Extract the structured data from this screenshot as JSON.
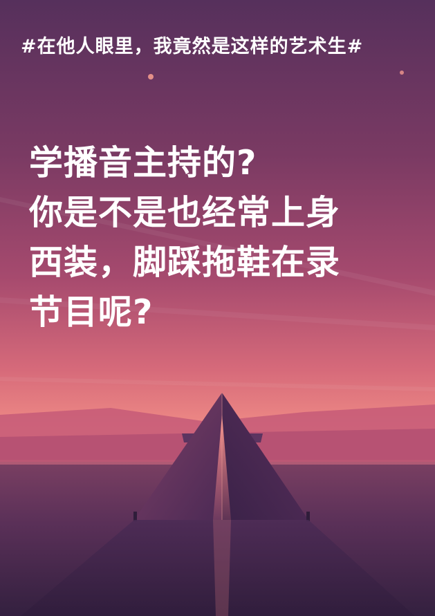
{
  "poster": {
    "hashtag": "#在他人眼里，我竟然是这样的艺术生#",
    "headline_lines": [
      "学播音主持的?",
      "你是不是也经常上身",
      "西装，脚踩拖鞋在录",
      "节目呢?"
    ]
  },
  "palette": {
    "sky_top": "#5a2f5e",
    "sky_mid": "#9a4a6c",
    "horizon": "#f08a8a",
    "ground": "#3c2448",
    "text": "#ffffff"
  }
}
